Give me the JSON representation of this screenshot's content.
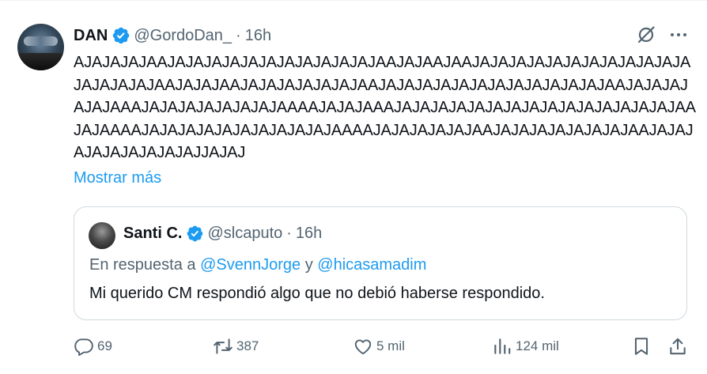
{
  "tweet": {
    "author_name": "DAN",
    "handle": "@GordoDan_",
    "separator": "·",
    "time": "16h",
    "text": "AJAJAJAJAAJAJAJAJAJAJAJAJAJAJAJAJAAJAJAAJAAJAJAJAJAJAJAJAJAJAJAJAJAJAJAJAJAJAAJAJAJAAJAJAJAJAJAJAJAAJAJAJAJAJAJAJAJAJAJAJAJAJAAJAJAJAJAJAJAAAJAJAJAJAJAJAJAJAAAAJAJAJAAAJAJAJAJAJAJAJAJAJAJAJAJAJAJAJAJAAJAJAAAAJAJAJAJAJAJAJAJAJAJAJAAAAJAJAJAJAJAJAAJAJAJAJAJAJAJAJAAJAJAJAJAJAJAJAJAJAJJAJAJ",
    "show_more": "Mostrar más"
  },
  "quote": {
    "author_name": "Santi C.",
    "handle": "@slcaputo",
    "separator": "·",
    "time": "16h",
    "reply_prefix": "En respuesta a",
    "reply_user1": "@SvennJorge",
    "reply_join": "y",
    "reply_user2": "@hicasamadim",
    "text": "Mi querido CM respondió algo que no debió haberse respondido."
  },
  "actions": {
    "replies": "69",
    "retweets": "387",
    "likes": "5 mil",
    "views": "124 mil"
  },
  "icons": [
    "verified-badge-icon",
    "grok-icon",
    "more-icon",
    "reply-icon",
    "retweet-icon",
    "like-icon",
    "views-icon",
    "bookmark-icon",
    "share-icon"
  ],
  "colors": {
    "accent": "#1d9bf0",
    "secondary_text": "#536471",
    "primary_text": "#0f1419",
    "border": "#cfd9de"
  }
}
